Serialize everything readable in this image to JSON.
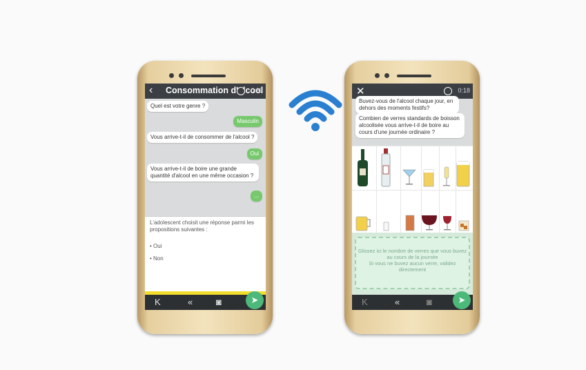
{
  "left_phone": {
    "title": "Consommation d'alcool",
    "time": "0:23",
    "back_icon": "chevron-left-icon",
    "messages": [
      "Quel est votre genre ?",
      "Masculin",
      "Vous arrive-t-il de consommer de l'alcool ?",
      "Oui",
      "Vous arrive-t-il de boire une grande quantité d'alcool en une même occasion ?",
      "..."
    ],
    "prompt_line1": "L'adolescent choisit une réponse parmi les",
    "prompt_line2": "propositions suivantes :",
    "options": [
      "• Oui",
      "• Non"
    ],
    "nav": {
      "first": "K",
      "prev": "«",
      "audio": "◙"
    }
  },
  "right_phone": {
    "time": "0:18",
    "close_icon": "close-icon",
    "messages": [
      "Buvez-vous de l'alcool chaque jour, en dehors des moments festifs?",
      "Combien de verres standards de boisson alcoolisée vous arrive-t-il de boire au cours d'une journée ordinaire ?"
    ],
    "dropzone_line1": "Glissez ici le nombre de verres que vous buvez",
    "dropzone_line2": "au cours de la journée",
    "dropzone_line3": "Si vous ne buvez aucun verre, validez",
    "dropzone_line4": "directement",
    "nav": {
      "first": "K",
      "prev": "«",
      "audio": "◙"
    }
  },
  "colors": {
    "accent_green": "#78c96e",
    "yellow": "#f2dd2c",
    "wifi_blue": "#2a7fd0",
    "phone_gold": "#e6cf9f"
  }
}
